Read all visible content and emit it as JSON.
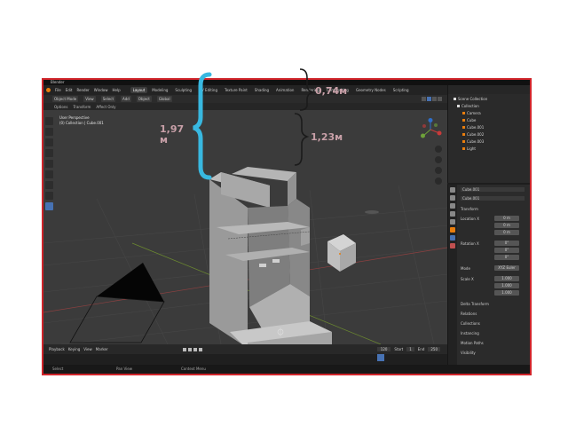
{
  "titlebar": {
    "app_name": "Blender"
  },
  "menubar": {
    "items": [
      "File",
      "Edit",
      "Render",
      "Window",
      "Help"
    ],
    "tabs": [
      "Layout",
      "Modeling",
      "Sculpting",
      "UV Editing",
      "Texture Paint",
      "Shading",
      "Animation",
      "Rendering",
      "Compositing",
      "Geometry Nodes",
      "Scripting"
    ],
    "active_tab": "Layout"
  },
  "toolheader": {
    "items": [
      "Object Mode",
      "View",
      "Select",
      "Add",
      "Object",
      "Global"
    ]
  },
  "toolheader2": {
    "items": [
      "Options",
      "Transform",
      "Affect Only"
    ]
  },
  "viewport": {
    "info_line1": "User Perspective",
    "info_line2": "(0) Collection | Cube.001"
  },
  "annotations": {
    "height_total": "1,97",
    "height_total_unit": "м",
    "width_top": "0,74м",
    "height_upper": "1,23м"
  },
  "timeline": {
    "items": [
      "Playback",
      "Keying",
      "View",
      "Marker"
    ],
    "current_frame": "120",
    "start_label": "Start",
    "start_value": "1",
    "end_label": "End",
    "end_value": "250"
  },
  "statusbar": {
    "left": "Select",
    "middle": "Pan View",
    "right": "Context Menu"
  },
  "outliner": {
    "title": "Scene Collection",
    "collection": "Collection",
    "items": [
      "Camera",
      "Cube",
      "Cube.001",
      "Cube.002",
      "Cube.003",
      "Light"
    ]
  },
  "properties": {
    "object_name": "Cube.001",
    "mesh_name": "Cube.001",
    "section_transform": "Transform",
    "location_label": "Location X",
    "loc_x": "0 m",
    "loc_y": "0 m",
    "loc_z": "0 m",
    "rotation_label": "Rotation X",
    "rot_x": "0°",
    "rot_y": "0°",
    "rot_z": "0°",
    "mode_label": "Mode",
    "mode_value": "XYZ Euler",
    "scale_label": "Scale X",
    "scale_x": "1.000",
    "scale_y": "1.000",
    "scale_z": "1.000",
    "delta_label": "Delta Transform",
    "relations_label": "Relations",
    "collections_label": "Collections",
    "instancing_label": "Instancing",
    "motion_paths_label": "Motion Paths",
    "visibility_label": "Visibility"
  },
  "colors": {
    "frame_border": "#d0242a",
    "brace": "#38b8e0",
    "annotation_text": "#c8a0a8",
    "active_tool": "#4772b3"
  }
}
